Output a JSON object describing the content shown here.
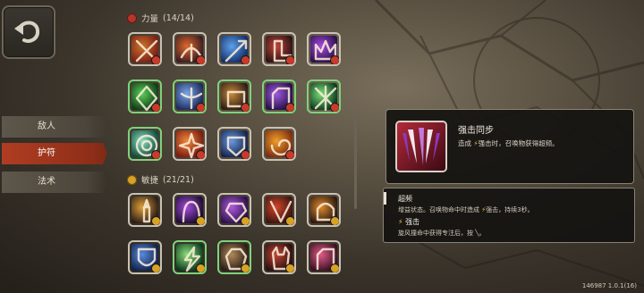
{
  "side_tabs": [
    {
      "label": "敌人"
    },
    {
      "label": "护符"
    },
    {
      "label": "法术"
    }
  ],
  "sections": {
    "strength": {
      "label": "力量",
      "count": "(14/14)"
    },
    "agility": {
      "label": "敏捷",
      "count": "(21/21)"
    }
  },
  "strength_icons": [
    {
      "row": 0,
      "col": 0,
      "border": "#c9c2b3",
      "c1": "#c9742a",
      "c2": "#7a1f16",
      "glyph": "claw-x"
    },
    {
      "row": 0,
      "col": 1,
      "border": "#c9c2b3",
      "c1": "#e06a2a",
      "c2": "#3a1c22",
      "glyph": "bird"
    },
    {
      "row": 0,
      "col": 2,
      "border": "#c9c2b3",
      "c1": "#5ea0e8",
      "c2": "#14306a",
      "glyph": "sword"
    },
    {
      "row": 0,
      "col": 3,
      "border": "#c9c2b3",
      "c1": "#c0463a",
      "c2": "#2a1214",
      "glyph": "boot"
    },
    {
      "row": 0,
      "col": 4,
      "border": "#c9c2b3",
      "c1": "#a64be0",
      "c2": "#2a1048",
      "glyph": "crown"
    },
    {
      "row": 1,
      "col": 0,
      "border": "#7fd27a",
      "c1": "#5cd05a",
      "c2": "#0f3a14",
      "glyph": "diamond"
    },
    {
      "row": 1,
      "col": 1,
      "border": "#7fd27a",
      "c1": "#7aa8e8",
      "c2": "#1c2a5a",
      "glyph": "angel"
    },
    {
      "row": 1,
      "col": 2,
      "border": "#7fd27a",
      "c1": "#c98a3a",
      "c2": "#2a1c14",
      "glyph": "fist"
    },
    {
      "row": 1,
      "col": 3,
      "border": "#7fd27a",
      "c1": "#a05ae0",
      "c2": "#241046",
      "glyph": "hand"
    },
    {
      "row": 1,
      "col": 4,
      "border": "#7fd27a",
      "c1": "#7ee07a",
      "c2": "#0a3a1e",
      "glyph": "cross"
    },
    {
      "row": 2,
      "col": 0,
      "border": "#7fd27a",
      "c1": "#8fe0c0",
      "c2": "#0f4a3a",
      "glyph": "target"
    },
    {
      "row": 2,
      "col": 1,
      "border": "#c9c2b3",
      "c1": "#f08a3a",
      "c2": "#7a1a10",
      "glyph": "burst"
    },
    {
      "row": 2,
      "col": 2,
      "border": "#c9c2b3",
      "c1": "#6a9ae0",
      "c2": "#14224a",
      "glyph": "gauntlet"
    },
    {
      "row": 2,
      "col": 3,
      "border": "#c9c2b3",
      "c1": "#f0a02a",
      "c2": "#7a2a10",
      "glyph": "swirl"
    }
  ],
  "agility_icons": [
    {
      "row": 0,
      "col": 0,
      "border": "#c9c2b3",
      "c1": "#e0a03a",
      "c2": "#2a1c14",
      "glyph": "candle"
    },
    {
      "row": 0,
      "col": 1,
      "border": "#c9c2b3",
      "c1": "#a64be0",
      "c2": "#1c0c30",
      "glyph": "hood"
    },
    {
      "row": 0,
      "col": 2,
      "border": "#c9c2b3",
      "c1": "#b05ae0",
      "c2": "#2a1048",
      "glyph": "gem"
    },
    {
      "row": 0,
      "col": 3,
      "border": "#c9c2b3",
      "c1": "#d0462a",
      "c2": "#3a1410",
      "glyph": "v-mark"
    },
    {
      "row": 0,
      "col": 4,
      "border": "#c9c2b3",
      "c1": "#e08a2a",
      "c2": "#2a1810",
      "glyph": "helm"
    },
    {
      "row": 1,
      "col": 0,
      "border": "#c9c2b3",
      "c1": "#5a8ae0",
      "c2": "#10224a",
      "glyph": "shield"
    },
    {
      "row": 1,
      "col": 1,
      "border": "#7fd27a",
      "c1": "#8fe07a",
      "c2": "#0a3a1e",
      "glyph": "lightning"
    },
    {
      "row": 1,
      "col": 2,
      "border": "#7fd27a",
      "c1": "#b08a5a",
      "c2": "#2a1c14",
      "glyph": "beast"
    },
    {
      "row": 1,
      "col": 3,
      "border": "#c9c2b3",
      "c1": "#c04632",
      "c2": "#2a0e10",
      "glyph": "demon"
    },
    {
      "row": 1,
      "col": 4,
      "border": "#c9c2b3",
      "c1": "#e05a8a",
      "c2": "#3a1020",
      "glyph": "hand"
    }
  ],
  "tooltip": {
    "title": "强击同步",
    "desc_prefix": "造成",
    "desc_keyword": "强击",
    "desc_suffix": "时，召唤物获得超频。"
  },
  "keyword_panel": {
    "term1": "超频",
    "term1_desc_a": "增益状态。召唤物命中时造成",
    "term1_desc_kw": "强击",
    "term1_desc_b": "，持续3秒。",
    "term2": "强击",
    "term2_desc": "旋风撞命中获得专注后，按",
    "term2_desc_end": "。"
  },
  "version": "146987 1.0.1(16)",
  "colors": {
    "accent": "#b03d22",
    "highlight": "#f0c23a",
    "strength": "#b6352a",
    "agility": "#d8a225"
  }
}
